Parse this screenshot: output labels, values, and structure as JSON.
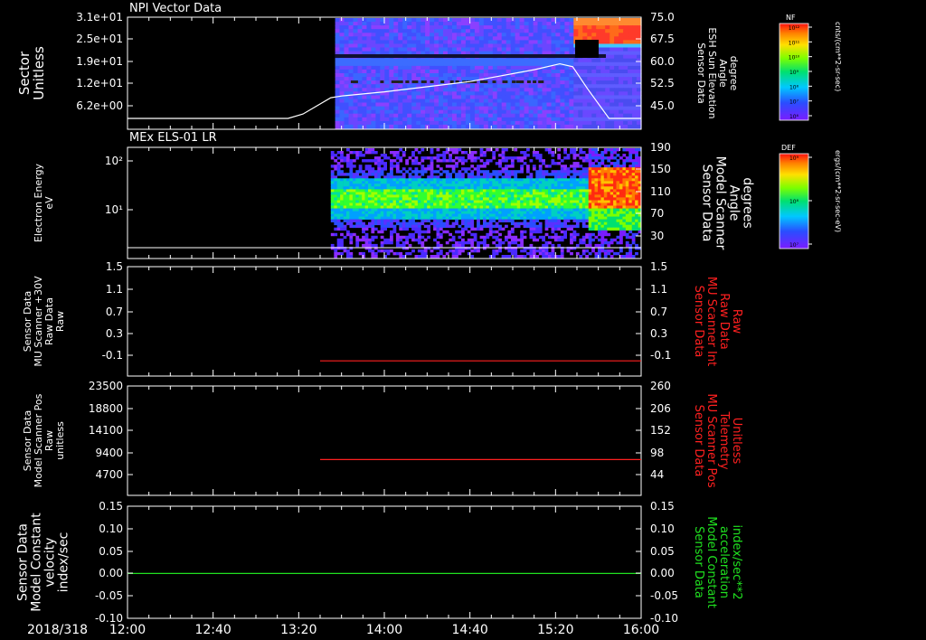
{
  "time_axis": {
    "date_label": "2018/318",
    "ticks": [
      "12:00",
      "12:40",
      "13:20",
      "14:00",
      "14:40",
      "15:20",
      "16:00"
    ],
    "range": [
      "12:00",
      "16:00"
    ]
  },
  "panels": [
    {
      "id": "panel-npi",
      "title": "NPI Vector Data",
      "left_label": [
        "Sector",
        "Unitless"
      ],
      "left_ticks": [
        "3.1e+01",
        "2.5e+01",
        "1.9e+01",
        "1.2e+01",
        "6.2e+00"
      ],
      "right_label": [
        "Sensor Data",
        "ESH Sun Elevation",
        "Angle",
        "degree"
      ],
      "right_ticks": [
        "75.0",
        "67.5",
        "60.0",
        "52.5",
        "45.0"
      ],
      "colorbar": {
        "title": "NF",
        "ticks": [
          "10¹²",
          "10¹¹",
          "10¹⁰",
          "10⁹",
          "10⁸",
          "10⁷",
          "10⁶"
        ],
        "unit": "cnts/(cm**2-sr-sec)"
      }
    },
    {
      "id": "panel-els",
      "title": "MEx ELS-01 LR",
      "left_label": [
        "Electron Energy",
        "eV"
      ],
      "left_ticks": [
        "10²",
        "10¹"
      ],
      "right_label": [
        "Sensor Data",
        "Model Scanner",
        "Angle",
        "degrees"
      ],
      "right_ticks": [
        "190",
        "150",
        "110",
        "70",
        "30"
      ],
      "colorbar": {
        "title": "DEF",
        "ticks": [
          "10⁹",
          "10⁸",
          "10⁷"
        ],
        "unit": "ergs/(cm**2-sr-sec-eV)"
      }
    },
    {
      "id": "panel-mu-int",
      "left_label": [
        "Sensor Data",
        "MU Scanner +30V",
        "Raw Data",
        "Raw"
      ],
      "left_ticks": [
        "1.5",
        "1.1",
        "0.7",
        "0.3",
        "-0.1"
      ],
      "right_label": [
        "Sensor Data",
        "MU Scanner Int",
        "Raw Data",
        "Raw"
      ],
      "right_ticks": [
        "1.5",
        "1.1",
        "0.7",
        "0.3",
        "-0.1"
      ]
    },
    {
      "id": "panel-mu-pos",
      "left_label": [
        "Sensor Data",
        "Model Scanner Pos",
        "Raw",
        "unitless"
      ],
      "left_ticks": [
        "23500",
        "18800",
        "14100",
        "9400",
        "4700"
      ],
      "right_label": [
        "Sensor Data",
        "MU Scanner Pos",
        "Telemetry",
        "Unitless"
      ],
      "right_ticks": [
        "260",
        "206",
        "152",
        "98",
        "44"
      ]
    },
    {
      "id": "panel-const",
      "left_label": [
        "Sensor Data",
        "Model Constant",
        "velocity",
        "index/sec"
      ],
      "left_ticks": [
        "0.15",
        "0.10",
        "0.05",
        "0.00",
        "-0.05",
        "-0.10"
      ],
      "right_label": [
        "Sensor Data",
        "Model Constant",
        "acceleration",
        "index/sec**2"
      ],
      "right_ticks": [
        "0.15",
        "0.10",
        "0.05",
        "0.00",
        "-0.05",
        "-0.10"
      ]
    }
  ],
  "colors": {
    "background": "#000000",
    "axes": "#ffffff",
    "red_series": "#ff2020",
    "green_series": "#20e020"
  },
  "chart_data": [
    {
      "type": "heatmap",
      "title": "NPI Vector Data",
      "ylabel": "Sector Unitless",
      "xlim": [
        "12:00",
        "16:00"
      ],
      "data_start": "13:37",
      "overlay_line": {
        "name": "ESH Sun Elevation Angle",
        "x": [
          "12:00",
          "13:15",
          "13:22",
          "13:35",
          "13:40",
          "14:00",
          "14:40",
          "15:10",
          "15:22",
          "15:28",
          "15:35",
          "15:45",
          "16:00"
        ],
        "y": [
          45.0,
          45.0,
          46.5,
          52.0,
          52.6,
          54.0,
          57.5,
          61.5,
          63.5,
          62.5,
          55.0,
          45.0,
          45.0
        ]
      }
    },
    {
      "type": "heatmap",
      "title": "MEx ELS-01 LR",
      "ylabel": "Electron Energy eV",
      "xlim": [
        "12:00",
        "16:00"
      ],
      "data_start": "13:35",
      "overlay_line": {
        "name": "Model Scanner Angle",
        "x": [
          "12:00",
          "16:00"
        ],
        "y": [
          5,
          5
        ]
      }
    },
    {
      "type": "line",
      "series": [
        {
          "name": "MU Scanner Int",
          "x": [
            "13:30",
            "16:00"
          ],
          "y": [
            -0.05,
            -0.05
          ]
        }
      ],
      "xlim": [
        "12:00",
        "16:00"
      ],
      "ylim": [
        -0.3,
        1.5
      ]
    },
    {
      "type": "line",
      "series": [
        {
          "name": "MU Scanner Pos",
          "x": [
            "13:30",
            "16:00"
          ],
          "y": [
            85,
            85
          ]
        }
      ],
      "xlim": [
        "12:00",
        "16:00"
      ],
      "ylim": [
        0,
        260
      ]
    },
    {
      "type": "line",
      "series": [
        {
          "name": "Model Constant acceleration",
          "x": [
            "12:00",
            "16:00"
          ],
          "y": [
            0.0,
            0.0
          ]
        }
      ],
      "xlim": [
        "12:00",
        "16:00"
      ],
      "ylim": [
        -0.1,
        0.15
      ]
    }
  ]
}
